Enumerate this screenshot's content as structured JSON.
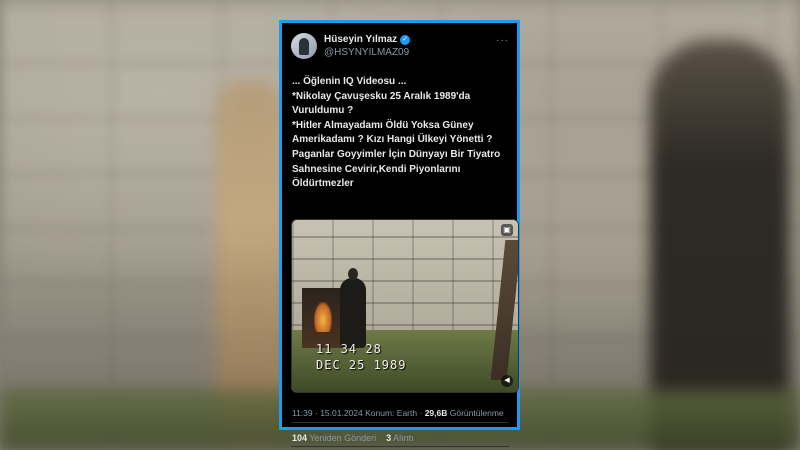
{
  "tweet": {
    "author_name": "Hüseyin Yılmaz",
    "verified_icon": "verified-badge-icon",
    "handle": "@HSYNYILMAZ09",
    "more_label": "···",
    "lines": [
      "... Öğlenin  IQ  Videosu ...",
      "*Nikolay Çavuşesku 25 Aralık 1989'da Vuruldumu ?",
      "*Hitler Almayadamı Öldü Yoksa Güney Amerikadamı ? Kızı Hangi Ülkeyi Yönetti ?",
      "Paganlar Goyyimler İçin Dünyayı Bir Tiyatro Sahnesine Cevirir,Kendi Piyonlarını Öldürtmezler"
    ],
    "media": {
      "timestamp_time": "11 34 28",
      "timestamp_date": "DEC 25 1989",
      "gif_icon": "gif-icon",
      "volume_icon": "volume-icon"
    },
    "meta": {
      "time_date": "11:39 · 15.01.2024",
      "location": "Konum: Earth",
      "separator": "·",
      "views_count": "29,6B",
      "views_label": "Görüntülenme"
    },
    "stats": {
      "reposts_count": "104",
      "reposts_label": "Yeniden Gönderi",
      "quotes_count": "3",
      "quotes_label": "Alıntı"
    }
  },
  "colors": {
    "accent_border": "#1d9bf0",
    "card_background": "#000000",
    "muted_text": "#8b98a5"
  }
}
